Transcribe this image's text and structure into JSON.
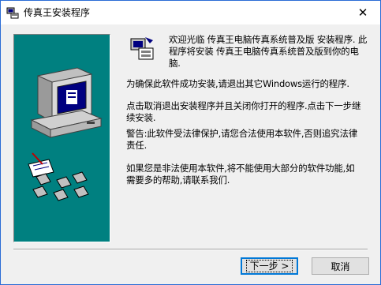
{
  "window": {
    "title": "传真王安装程序",
    "close_symbol": "✕"
  },
  "icons": {
    "app": "setup-icon",
    "banner": "computer-install-illustration"
  },
  "content": {
    "welcome": "欢迎光临 传真王电脑传真系统普及版 安装程序. 此程序将安装 传真王电脑传真系统普及版到你的电脑.",
    "p1": "为确保此软件成功安装,请退出其它Windows运行的程序.",
    "p2": "点击取消退出安装程序并且关闭你打开的程序.点击下一步继续安装.",
    "p3": "警告:此软件受法律保护,请您合法使用本软件,否则追究法律责任.",
    "p4": "如果您是非法使用本软件,将不能使用大部分的软件功能,如需要多的帮助,请联系我们."
  },
  "buttons": {
    "next": "下一步 >",
    "cancel": "取消"
  },
  "colors": {
    "banner": "#008080",
    "accent": "#0078d7"
  }
}
